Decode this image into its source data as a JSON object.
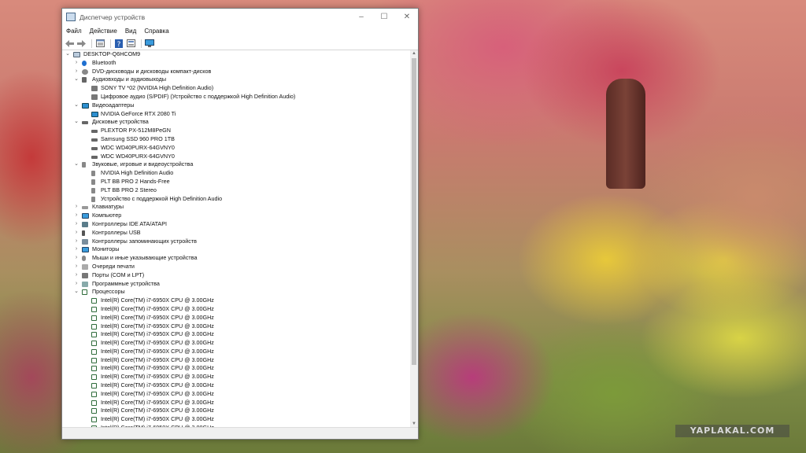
{
  "window": {
    "title": "Диспетчер устройств",
    "controls": {
      "minimize": "–",
      "maximize": "☐",
      "close": "✕"
    }
  },
  "menu": [
    "Файл",
    "Действие",
    "Вид",
    "Справка"
  ],
  "toolbar": {
    "back_icon": "arrow-left-icon",
    "forward_icon": "arrow-right-icon",
    "properties_icon": "properties-icon",
    "help_icon": "help-icon",
    "view_icon": "view-icon",
    "monitor_icon": "monitor-icon"
  },
  "tree": [
    {
      "text": "DESKTOP-Q6HCOM9",
      "level": 0,
      "exp": "v",
      "icon": "pc"
    },
    {
      "text": "Bluetooth",
      "level": 1,
      "exp": ">",
      "icon": "bt"
    },
    {
      "text": "DVD-дисководы и дисководы компакт-дисков",
      "level": 1,
      "exp": ">",
      "icon": "dvd"
    },
    {
      "text": "Аудиовходы и аудиовыходы",
      "level": 1,
      "exp": "v",
      "icon": "audio"
    },
    {
      "text": "SONY TV  *02 (NVIDIA High Definition Audio)",
      "level": 2,
      "exp": "",
      "icon": "spk"
    },
    {
      "text": "Цифровое аудио (S/PDIF) (Устройство с поддержкой High Definition Audio)",
      "level": 2,
      "exp": "",
      "icon": "spk"
    },
    {
      "text": "Видеоадаптеры",
      "level": 1,
      "exp": "v",
      "icon": "disp"
    },
    {
      "text": "NVIDIA GeForce RTX 2080 Ti",
      "level": 2,
      "exp": "",
      "icon": "disp"
    },
    {
      "text": "Дисковые устройства",
      "level": 1,
      "exp": "v",
      "icon": "disk"
    },
    {
      "text": "PLEXTOR PX-512M8PeGN",
      "level": 2,
      "exp": "",
      "icon": "disk"
    },
    {
      "text": "Samsung SSD 960 PRO 1TB",
      "level": 2,
      "exp": "",
      "icon": "disk"
    },
    {
      "text": "WDC WD40PURX-64GVNY0",
      "level": 2,
      "exp": "",
      "icon": "disk"
    },
    {
      "text": "WDC WD40PURX-64GVNY0",
      "level": 2,
      "exp": "",
      "icon": "disk"
    },
    {
      "text": "Звуковые, игровые и видеоустройства",
      "level": 1,
      "exp": "v",
      "icon": "snd"
    },
    {
      "text": "NVIDIA High Definition Audio",
      "level": 2,
      "exp": "",
      "icon": "snd"
    },
    {
      "text": "PLT BB PRO 2 Hands-Free",
      "level": 2,
      "exp": "",
      "icon": "snd"
    },
    {
      "text": "PLT BB PRO 2 Stereo",
      "level": 2,
      "exp": "",
      "icon": "snd"
    },
    {
      "text": "Устройство с поддержкой High Definition Audio",
      "level": 2,
      "exp": "",
      "icon": "snd"
    },
    {
      "text": "Клавиатуры",
      "level": 1,
      "exp": ">",
      "icon": "kbd"
    },
    {
      "text": "Компьютер",
      "level": 1,
      "exp": ">",
      "icon": "mon"
    },
    {
      "text": "Контроллеры IDE ATA/ATAPI",
      "level": 1,
      "exp": ">",
      "icon": "ide"
    },
    {
      "text": "Контроллеры USB",
      "level": 1,
      "exp": ">",
      "icon": "usb"
    },
    {
      "text": "Контроллеры запоминающих устройств",
      "level": 1,
      "exp": ">",
      "icon": "stor"
    },
    {
      "text": "Мониторы",
      "level": 1,
      "exp": ">",
      "icon": "mon"
    },
    {
      "text": "Мыши и иные указывающие устройства",
      "level": 1,
      "exp": ">",
      "icon": "mouse"
    },
    {
      "text": "Очереди печати",
      "level": 1,
      "exp": ">",
      "icon": "print"
    },
    {
      "text": "Порты (COM и LPT)",
      "level": 1,
      "exp": ">",
      "icon": "port"
    },
    {
      "text": "Программные устройства",
      "level": 1,
      "exp": ">",
      "icon": "sw"
    },
    {
      "text": "Процессоры",
      "level": 1,
      "exp": "v",
      "icon": "cpu"
    },
    {
      "text": "Intel(R) Core(TM) i7-6950X CPU @ 3.00GHz",
      "level": 2,
      "exp": "",
      "icon": "cpu"
    },
    {
      "text": "Intel(R) Core(TM) i7-6950X CPU @ 3.00GHz",
      "level": 2,
      "exp": "",
      "icon": "cpu"
    },
    {
      "text": "Intel(R) Core(TM) i7-6950X CPU @ 3.00GHz",
      "level": 2,
      "exp": "",
      "icon": "cpu"
    },
    {
      "text": "Intel(R) Core(TM) i7-6950X CPU @ 3.00GHz",
      "level": 2,
      "exp": "",
      "icon": "cpu"
    },
    {
      "text": "Intel(R) Core(TM) i7-6950X CPU @ 3.00GHz",
      "level": 2,
      "exp": "",
      "icon": "cpu"
    },
    {
      "text": "Intel(R) Core(TM) i7-6950X CPU @ 3.00GHz",
      "level": 2,
      "exp": "",
      "icon": "cpu"
    },
    {
      "text": "Intel(R) Core(TM) i7-6950X CPU @ 3.00GHz",
      "level": 2,
      "exp": "",
      "icon": "cpu"
    },
    {
      "text": "Intel(R) Core(TM) i7-6950X CPU @ 3.00GHz",
      "level": 2,
      "exp": "",
      "icon": "cpu"
    },
    {
      "text": "Intel(R) Core(TM) i7-6950X CPU @ 3.00GHz",
      "level": 2,
      "exp": "",
      "icon": "cpu"
    },
    {
      "text": "Intel(R) Core(TM) i7-6950X CPU @ 3.00GHz",
      "level": 2,
      "exp": "",
      "icon": "cpu"
    },
    {
      "text": "Intel(R) Core(TM) i7-6950X CPU @ 3.00GHz",
      "level": 2,
      "exp": "",
      "icon": "cpu"
    },
    {
      "text": "Intel(R) Core(TM) i7-6950X CPU @ 3.00GHz",
      "level": 2,
      "exp": "",
      "icon": "cpu"
    },
    {
      "text": "Intel(R) Core(TM) i7-6950X CPU @ 3.00GHz",
      "level": 2,
      "exp": "",
      "icon": "cpu"
    },
    {
      "text": "Intel(R) Core(TM) i7-6950X CPU @ 3.00GHz",
      "level": 2,
      "exp": "",
      "icon": "cpu"
    },
    {
      "text": "Intel(R) Core(TM) i7-6950X CPU @ 3.00GHz",
      "level": 2,
      "exp": "",
      "icon": "cpu"
    },
    {
      "text": "Intel(R) Core(TM) i7-6950X CPU @ 3.00GHz",
      "level": 2,
      "exp": "",
      "icon": "cpu"
    }
  ],
  "watermark": "YAPLAKAL.COM"
}
